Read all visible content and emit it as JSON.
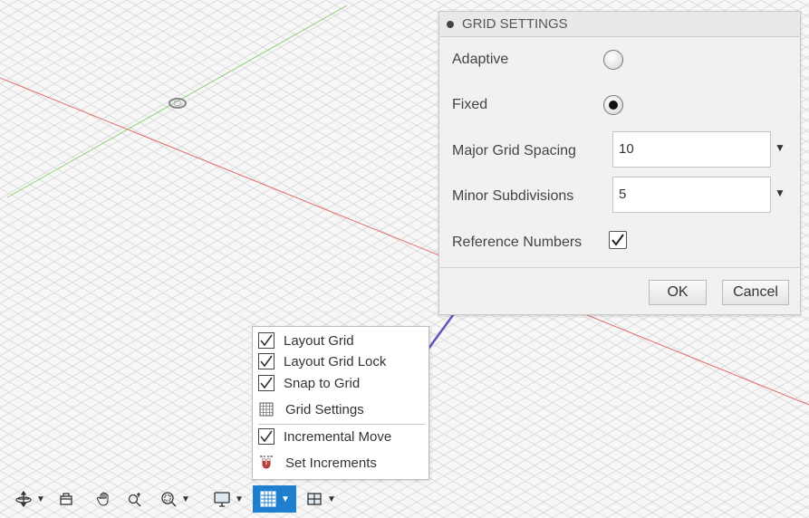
{
  "dialog": {
    "title": "GRID SETTINGS",
    "adaptive_label": "Adaptive",
    "fixed_label": "Fixed",
    "major_label": "Major Grid Spacing",
    "major_value": "10",
    "minor_label": "Minor Subdivisions",
    "minor_value": "5",
    "refnum_label": "Reference Numbers",
    "ok_label": "OK",
    "cancel_label": "Cancel",
    "selected_mode": "Fixed",
    "reference_numbers_checked": true
  },
  "menu": {
    "items": [
      {
        "label": "Layout Grid",
        "checked": true,
        "icon": "checkbox"
      },
      {
        "label": "Layout Grid Lock",
        "checked": true,
        "icon": "checkbox"
      },
      {
        "label": "Snap to Grid",
        "checked": true,
        "icon": "checkbox"
      },
      {
        "label": "Grid Settings",
        "icon": "grid-icon"
      },
      {
        "label": "Incremental Move",
        "checked": true,
        "icon": "checkbox"
      },
      {
        "label": "Set Increments",
        "icon": "magnet-icon"
      }
    ]
  },
  "toolbar": {
    "tools": [
      "orbit-icon",
      "look-at-icon",
      "pan-hand-icon",
      "zoom-icon",
      "fit-icon",
      "display-settings-icon",
      "grid-snaps-icon",
      "viewports-icon"
    ],
    "active_tool": "grid-snaps-icon"
  },
  "colors": {
    "accent": "#1f7fcf",
    "annotation_arrow": "#6650b8",
    "x_axis": "#e36d6d",
    "y_axis": "#8ccf7a"
  }
}
